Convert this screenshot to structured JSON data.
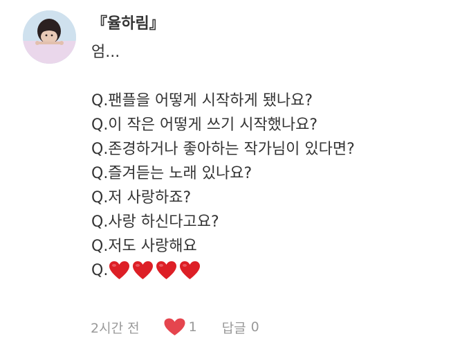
{
  "comment": {
    "author": "『율하림』",
    "lines": [
      "엄...",
      "",
      "Q.팬플을 어떻게 시작하게 됐나요?",
      "Q.이 작은 어떻게 쓰기 시작했나요?",
      "Q.존경하거나 좋아하는 작가님이 있다면?",
      "Q.즐겨듣는 노래 있나요?",
      "Q.저 사랑하죠?",
      "Q.사랑 하신다고요?",
      "Q.저도 사랑해요"
    ],
    "last_line_prefix": "Q.",
    "last_line_emoji": [
      "heart-emoji",
      "heart-emoji",
      "heart-emoji",
      "heart-emoji"
    ],
    "time": "2시간 전",
    "like_count": "1",
    "reply_label": "답글",
    "reply_count": "0"
  },
  "colors": {
    "text": "#333333",
    "meta": "#999999",
    "heart": "#e5454e",
    "emoji_heart": "#dd1f26",
    "avatar_top": "#cfe1ee",
    "avatar_bottom": "#e9d6ea"
  }
}
